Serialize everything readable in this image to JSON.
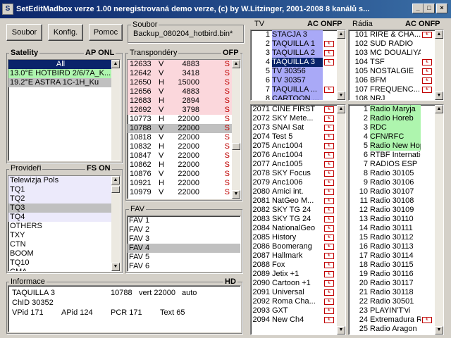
{
  "title": {
    "text": "SetEditMadbox verze  1.00  neregistrovaná demo verze, (c) by W.Litzinger, 2001-2008 8  kanálů s..."
  },
  "toolbar": {
    "soubor": "Soubor",
    "konfig": "Konfig.",
    "pomoc": "Pomoc"
  },
  "file": {
    "label": "Soubor",
    "name": "Backup_080204_hotbird.bin*"
  },
  "satellites": {
    "label": "Satelity",
    "flags": "AP ONL",
    "items": [
      {
        "name": "All",
        "style": "hot"
      },
      {
        "name": "13.0°E  HOTBIRD 2/6/7A_K...",
        "style": "green"
      },
      {
        "name": "19.2°E  ASTRA 1C-1H_Ku",
        "style": "sel"
      }
    ]
  },
  "transponders": {
    "label": "Transpondéry",
    "flags": "OFP",
    "items": [
      {
        "freq": "12633",
        "pol": "V",
        "sr": "4883",
        "flag": "S",
        "style": "pink"
      },
      {
        "freq": "12642",
        "pol": "V",
        "sr": "3418",
        "flag": "S",
        "style": "pink"
      },
      {
        "freq": "12650",
        "pol": "H",
        "sr": "15000",
        "flag": "S",
        "style": "pink"
      },
      {
        "freq": "12656",
        "pol": "V",
        "sr": "4883",
        "flag": "S",
        "style": "pink"
      },
      {
        "freq": "12683",
        "pol": "H",
        "sr": "2894",
        "flag": "S",
        "style": "pink"
      },
      {
        "freq": "12692",
        "pol": "V",
        "sr": "3798",
        "flag": "S",
        "style": "pink"
      },
      {
        "freq": "10773",
        "pol": "H",
        "sr": "22000",
        "flag": "S",
        "style": ""
      },
      {
        "freq": "10788",
        "pol": "V",
        "sr": "22000",
        "flag": "S",
        "style": "sel"
      },
      {
        "freq": "10818",
        "pol": "V",
        "sr": "22000",
        "flag": "S",
        "style": ""
      },
      {
        "freq": "10832",
        "pol": "H",
        "sr": "22000",
        "flag": "S",
        "style": ""
      },
      {
        "freq": "10847",
        "pol": "V",
        "sr": "22000",
        "flag": "S",
        "style": ""
      },
      {
        "freq": "10862",
        "pol": "H",
        "sr": "22000",
        "flag": "S",
        "style": ""
      },
      {
        "freq": "10876",
        "pol": "V",
        "sr": "22000",
        "flag": "S",
        "style": ""
      },
      {
        "freq": "10921",
        "pol": "H",
        "sr": "22000",
        "flag": "S",
        "style": ""
      },
      {
        "freq": "10979",
        "pol": "V",
        "sr": "22000",
        "flag": "S",
        "style": ""
      }
    ]
  },
  "providers": {
    "label": "Provideři",
    "flags": "FS  ON",
    "items": [
      {
        "name": "Telewizja Pols",
        "style": "lav"
      },
      {
        "name": "TQ1",
        "style": "lav"
      },
      {
        "name": "TQ2",
        "style": "lav"
      },
      {
        "name": "TQ3",
        "style": "sel"
      },
      {
        "name": "TQ4",
        "style": "lav"
      },
      {
        "name": "OTHERS",
        "style": ""
      },
      {
        "name": "TXY",
        "style": ""
      },
      {
        "name": "CTN",
        "style": ""
      },
      {
        "name": "BOOM",
        "style": ""
      },
      {
        "name": "TQ10",
        "style": ""
      },
      {
        "name": "CMA",
        "style": ""
      }
    ]
  },
  "fav": {
    "label": "FAV",
    "items": [
      {
        "name": "FAV 1",
        "style": ""
      },
      {
        "name": "FAV 2",
        "style": ""
      },
      {
        "name": "FAV 3",
        "style": ""
      },
      {
        "name": "FAV 4",
        "style": "sel"
      },
      {
        "name": "FAV 5",
        "style": ""
      },
      {
        "name": "FAV 6",
        "style": ""
      }
    ]
  },
  "tv": {
    "label": "TV",
    "flags": "AC ONFP",
    "top": [
      {
        "num": "1",
        "name": "STACJA 3",
        "style": "blue",
        "enc": false
      },
      {
        "num": "2",
        "name": "TAQUILLA 1",
        "style": "blue",
        "enc": true
      },
      {
        "num": "3",
        "name": "TAQUILLA 2",
        "style": "blue",
        "enc": true
      },
      {
        "num": "4",
        "name": "TAQUILLA 3",
        "style": "hot",
        "enc": true
      },
      {
        "num": "5",
        "name": "TV 30356",
        "style": "blue",
        "enc": false
      },
      {
        "num": "6",
        "name": "TV 30357",
        "style": "blue",
        "enc": false
      },
      {
        "num": "7",
        "name": "TAQUILLA ...",
        "style": "blue",
        "enc": true
      },
      {
        "num": "8",
        "name": "CARTOON ...",
        "style": "blue",
        "enc": false
      }
    ],
    "bottom": [
      {
        "num": "2071",
        "name": "CINE FIRST",
        "enc": true
      },
      {
        "num": "2072",
        "name": "SKY Mete...",
        "enc": true
      },
      {
        "num": "2073",
        "name": "SNAI Sat",
        "enc": true
      },
      {
        "num": "2074",
        "name": "Test 5",
        "enc": true
      },
      {
        "num": "2075",
        "name": "Anc1004",
        "enc": true
      },
      {
        "num": "2076",
        "name": "Anc1004",
        "enc": true
      },
      {
        "num": "2077",
        "name": "Anc1005",
        "enc": true
      },
      {
        "num": "2078",
        "name": "SKY Focus",
        "enc": true
      },
      {
        "num": "2079",
        "name": "Anc1006",
        "enc": true
      },
      {
        "num": "2080",
        "name": "Amici int.",
        "enc": true
      },
      {
        "num": "2081",
        "name": "NatGeo M...",
        "enc": true
      },
      {
        "num": "2082",
        "name": "SKY TG 24",
        "enc": true
      },
      {
        "num": "2083",
        "name": "SKY TG 24",
        "enc": true
      },
      {
        "num": "2084",
        "name": "NationalGeo",
        "enc": true
      },
      {
        "num": "2085",
        "name": "History",
        "enc": true
      },
      {
        "num": "2086",
        "name": "Boomerang",
        "enc": true
      },
      {
        "num": "2087",
        "name": "Hallmark",
        "enc": true
      },
      {
        "num": "2088",
        "name": "Fox",
        "enc": true
      },
      {
        "num": "2089",
        "name": "Jetix +1",
        "enc": true
      },
      {
        "num": "2090",
        "name": "Cartoon +1",
        "enc": true
      },
      {
        "num": "2091",
        "name": "Universal",
        "enc": true
      },
      {
        "num": "2092",
        "name": "Roma Cha...",
        "enc": true
      },
      {
        "num": "2093",
        "name": "GXT",
        "enc": true
      },
      {
        "num": "2094",
        "name": "New Ch4",
        "enc": true
      }
    ]
  },
  "radio": {
    "label": "Rádia",
    "flags": "AC ONFP",
    "top": [
      {
        "num": "101",
        "name": "RIRE & CHA...",
        "enc": true
      },
      {
        "num": "102",
        "name": "SUD RADIO",
        "enc": false
      },
      {
        "num": "103",
        "name": "MC DOUALIYA",
        "enc": false
      },
      {
        "num": "104",
        "name": "TSF",
        "enc": true
      },
      {
        "num": "105",
        "name": "NOSTALGIE",
        "enc": true
      },
      {
        "num": "106",
        "name": "BFM",
        "enc": true
      },
      {
        "num": "107",
        "name": "FREQUENC...",
        "enc": true
      },
      {
        "num": "108",
        "name": "NRJ",
        "enc": false
      }
    ],
    "bottom": [
      {
        "num": "1",
        "name": "Radio Maryja",
        "style": "green",
        "enc": false
      },
      {
        "num": "2",
        "name": "Radio Horeb",
        "style": "green",
        "enc": false
      },
      {
        "num": "3",
        "name": "RDC",
        "style": "green",
        "enc": false
      },
      {
        "num": "4",
        "name": "CFN/RFC",
        "style": "green",
        "enc": false
      },
      {
        "num": "5",
        "name": "Radio New Hope",
        "style": "green",
        "enc": false
      },
      {
        "num": "6",
        "name": "RTBF International",
        "style": "",
        "enc": false
      },
      {
        "num": "7",
        "name": "RADIOS ESP",
        "style": "",
        "enc": false
      },
      {
        "num": "8",
        "name": "Radio 30105",
        "style": "",
        "enc": false
      },
      {
        "num": "9",
        "name": "Radio 30106",
        "style": "",
        "enc": false
      },
      {
        "num": "10",
        "name": "Radio 30107",
        "style": "",
        "enc": false
      },
      {
        "num": "11",
        "name": "Radio 30108",
        "style": "",
        "enc": false
      },
      {
        "num": "12",
        "name": "Radio 30109",
        "style": "",
        "enc": false
      },
      {
        "num": "13",
        "name": "Radio 30110",
        "style": "",
        "enc": false
      },
      {
        "num": "14",
        "name": "Radio 30111",
        "style": "",
        "enc": false
      },
      {
        "num": "15",
        "name": "Radio 30112",
        "style": "",
        "enc": false
      },
      {
        "num": "16",
        "name": "Radio 30113",
        "style": "",
        "enc": false
      },
      {
        "num": "17",
        "name": "Radio 30114",
        "style": "",
        "enc": false
      },
      {
        "num": "18",
        "name": "Radio 30115",
        "style": "",
        "enc": false
      },
      {
        "num": "19",
        "name": "Radio 30116",
        "style": "",
        "enc": false
      },
      {
        "num": "20",
        "name": "Radio 30117",
        "style": "",
        "enc": false
      },
      {
        "num": "21",
        "name": "Radio 30118",
        "style": "",
        "enc": false
      },
      {
        "num": "22",
        "name": "Radio 30501",
        "style": "",
        "enc": false
      },
      {
        "num": "23",
        "name": "PLAYIN'T'vi",
        "style": "",
        "enc": false
      },
      {
        "num": "24",
        "name": "Extremadura Ra...",
        "style": "",
        "enc": true
      },
      {
        "num": "25",
        "name": "Radio Aragon",
        "style": "",
        "enc": false
      }
    ]
  },
  "info": {
    "label": "Informace",
    "flag": "HD",
    "name": "TAQUILLA 3",
    "freq": "10788",
    "pol_sr": "vert 22000",
    "mode": "auto",
    "chid": "ChID 30352",
    "vpid": "VPid 171",
    "apid": "APid 124",
    "pcr": "PCR 171",
    "text": "Text 65"
  },
  "colors": {
    "titlebar": "#0a246a",
    "selected": "#0a246a",
    "pink": "#fbd7dc",
    "green": "#aef5ae",
    "blue": "#a9a9f7",
    "lavender": "#eceafb",
    "encrypted": "#c00000"
  }
}
